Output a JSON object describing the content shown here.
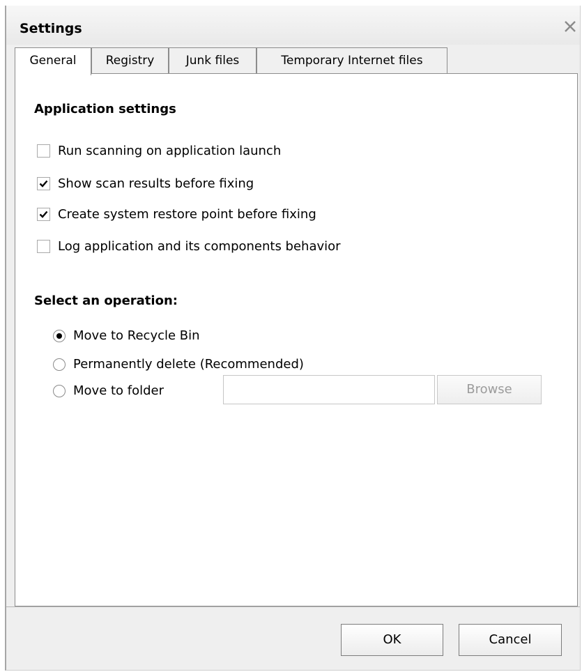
{
  "window": {
    "title": "Settings"
  },
  "tabs": [
    {
      "label": "General",
      "active": true
    },
    {
      "label": "Registry",
      "active": false
    },
    {
      "label": "Junk files",
      "active": false
    },
    {
      "label": "Temporary Internet files",
      "active": false
    }
  ],
  "app_settings": {
    "heading": "Application settings",
    "options": [
      {
        "label": "Run scanning on application launch",
        "checked": false
      },
      {
        "label": "Show scan results before fixing",
        "checked": true
      },
      {
        "label": "Create system restore point before fixing",
        "checked": true
      },
      {
        "label": "Log application and its components behavior",
        "checked": false
      }
    ]
  },
  "operation": {
    "heading": "Select an operation:",
    "options": [
      {
        "label": "Move to Recycle Bin",
        "selected": true
      },
      {
        "label": "Permanently delete  (Recommended)",
        "selected": false
      },
      {
        "label": "Move to folder",
        "selected": false
      }
    ],
    "folder_value": "",
    "browse_label": "Browse"
  },
  "footer": {
    "ok_label": "OK",
    "cancel_label": "Cancel"
  },
  "icons": {
    "close": "close-icon",
    "check": "checkmark-icon",
    "radio_dot": "radio-dot-icon"
  }
}
